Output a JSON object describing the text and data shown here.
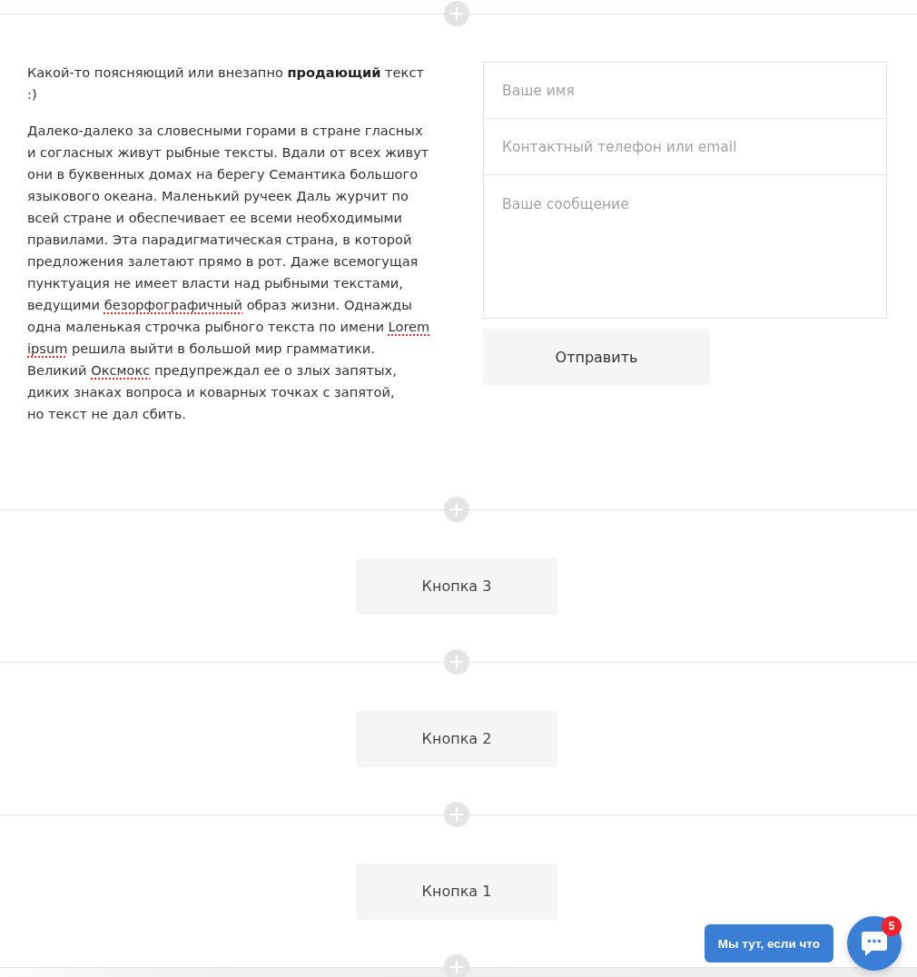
{
  "sections": [
    {
      "kind": "text_form",
      "lead": "Какой-то поясняющий или внезапно **продающий** текст :)",
      "body": [
        {
          "text": "Далеко-далеко за словесными горами в стране гласных и согласных живут рыбные тексты. Вдали от всех живут они в буквенных домах на берегу Семантика большого языкового океана. Маленький ручеек Даль журчит по всей стране и обеспечивает ее всеми необходимыми правилами. Эта парадигматическая страна, в которой предложения залетают прямо в рот. Даже всемогущая пунктуация не имеет власти над рыбными текстами, ведущими ",
          "misspelled": false
        },
        {
          "text": "безорфографичный",
          "misspelled": true
        },
        {
          "text": " образ жизни. Однажды одна маленькая строчка рыбного текста по имени ",
          "misspelled": false
        },
        {
          "text": "Lorem ipsum",
          "misspelled": true
        },
        {
          "text": " решила выйти в большой мир грамматики. Великий ",
          "misspelled": false
        },
        {
          "text": "Оксмокс",
          "misspelled": true
        },
        {
          "text": " предупреждал ее о злых запятых, диких знаках вопроса и коварных точках с запятой,\nно текст не дал сбить.",
          "misspelled": false
        }
      ],
      "form": {
        "fields": [
          {
            "kind": "input",
            "placeholder": "Ваше имя"
          },
          {
            "kind": "input",
            "placeholder": "Контактный телефон или email"
          },
          {
            "kind": "textarea",
            "placeholder": "Ваше сообщение"
          }
        ],
        "submit": "Отправить"
      }
    },
    {
      "kind": "button",
      "label": "Кнопка 3"
    },
    {
      "kind": "button",
      "label": "Кнопка 2"
    },
    {
      "kind": "button",
      "label": "Кнопка 1"
    }
  ],
  "chat_widget": {
    "prompt": "Мы тут, если что",
    "badge": "5"
  }
}
